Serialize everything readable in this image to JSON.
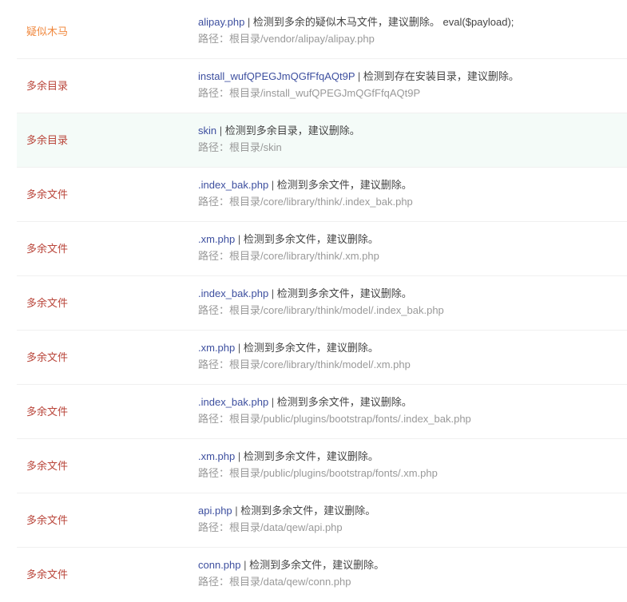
{
  "colors": {
    "trojan_type": "#f0883e",
    "extra_type": "#b9453a",
    "file_link": "#3d4f9f",
    "path_text": "#999999",
    "hover_row_bg": "#f4fbf8"
  },
  "separator": " | ",
  "rows": [
    {
      "type": "疑似木马",
      "file": "alipay.php",
      "message": "检测到多余的疑似木马文件，建议删除。 eval($payload);",
      "path": "路径：根目录/vendor/alipay/alipay.php"
    },
    {
      "type": "多余目录",
      "file": "install_wufQPEGJmQGfFfqAQt9P",
      "message": "检测到存在安装目录，建议删除。",
      "path": "路径：根目录/install_wufQPEGJmQGfFfqAQt9P"
    },
    {
      "type": "多余目录",
      "file": "skin",
      "message": "检测到多余目录，建议删除。",
      "path": "路径：根目录/skin"
    },
    {
      "type": "多余文件",
      "file": ".index_bak.php",
      "message": "检测到多余文件，建议删除。",
      "path": "路径：根目录/core/library/think/.index_bak.php"
    },
    {
      "type": "多余文件",
      "file": ".xm.php",
      "message": "检测到多余文件，建议删除。",
      "path": "路径：根目录/core/library/think/.xm.php"
    },
    {
      "type": "多余文件",
      "file": ".index_bak.php",
      "message": "检测到多余文件，建议删除。",
      "path": "路径：根目录/core/library/think/model/.index_bak.php"
    },
    {
      "type": "多余文件",
      "file": ".xm.php",
      "message": "检测到多余文件，建议删除。",
      "path": "路径：根目录/core/library/think/model/.xm.php"
    },
    {
      "type": "多余文件",
      "file": ".index_bak.php",
      "message": "检测到多余文件，建议删除。",
      "path": "路径：根目录/public/plugins/bootstrap/fonts/.index_bak.php"
    },
    {
      "type": "多余文件",
      "file": ".xm.php",
      "message": "检测到多余文件，建议删除。",
      "path": "路径：根目录/public/plugins/bootstrap/fonts/.xm.php"
    },
    {
      "type": "多余文件",
      "file": "api.php",
      "message": "检测到多余文件，建议删除。",
      "path": "路径：根目录/data/qew/api.php"
    },
    {
      "type": "多余文件",
      "file": "conn.php",
      "message": "检测到多余文件，建议删除。",
      "path": "路径：根目录/data/qew/conn.php"
    }
  ]
}
